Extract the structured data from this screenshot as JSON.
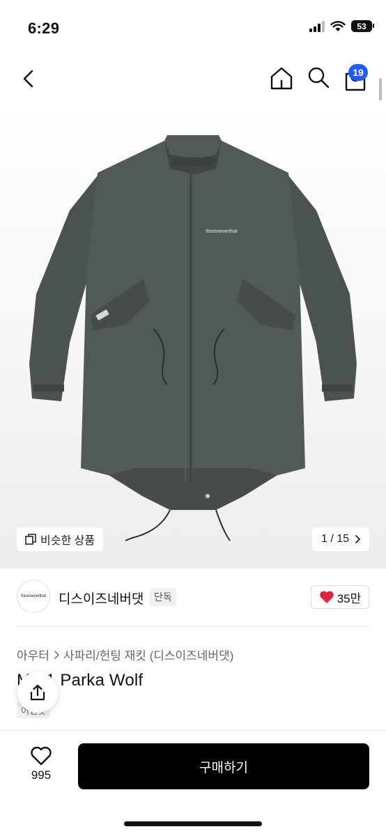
{
  "status": {
    "time": "6:29",
    "battery": "53"
  },
  "nav": {
    "cart_count": "19"
  },
  "gallery": {
    "similar_label": "비슷한 상품",
    "pager": "1 / 15",
    "print_text": "thisisneverthat"
  },
  "brand": {
    "logo_text": "thisisneverthat",
    "name": "디스이즈네버댓",
    "tag": "단독",
    "likes": "35만"
  },
  "breadcrumb": [
    "아우터",
    "사파리/헌팅 재킷 (디스이즈네버댓)"
  ],
  "product": {
    "title": "M-51 Parka Wolf",
    "subtag": "어쩜댓"
  },
  "bottom": {
    "wish_count": "995",
    "buy_label": "구매하기"
  },
  "colors": {
    "accent": "#1e5cff",
    "like": "#e0223a",
    "coat": "#4b5352"
  }
}
